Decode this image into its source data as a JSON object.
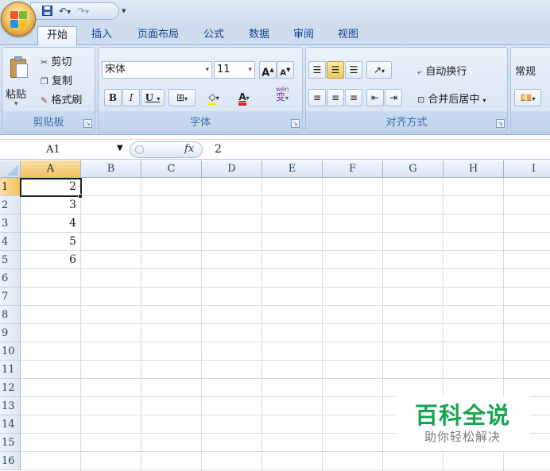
{
  "qat": {
    "save_icon": "save-icon",
    "undo_icon": "undo-icon",
    "redo_icon": "redo-icon",
    "more": "▾"
  },
  "tabs": [
    {
      "label": "开始",
      "active": true
    },
    {
      "label": "插入"
    },
    {
      "label": "页面布局"
    },
    {
      "label": "公式"
    },
    {
      "label": "数据"
    },
    {
      "label": "审阅"
    },
    {
      "label": "视图"
    }
  ],
  "clipboard": {
    "paste": "粘贴",
    "cut": "剪切",
    "copy": "复制",
    "format_painter": "格式刷",
    "group_label": "剪贴板"
  },
  "font": {
    "name": "宋体",
    "size": "11",
    "bold": "B",
    "italic": "I",
    "underline": "U",
    "font_color_glyph": "A",
    "grow": "A",
    "shrink": "A",
    "wen": "wén",
    "wen_char": "变",
    "group_label": "字体",
    "fill_color": "#f6e62a",
    "font_color": "#e0211d"
  },
  "alignment": {
    "wrap_text": "自动换行",
    "merge_center": "合并后居中",
    "group_label": "对齐方式"
  },
  "number": {
    "format": "常规"
  },
  "formula_bar": {
    "name_box": "A1",
    "fx": "fx",
    "value": "2"
  },
  "sheet": {
    "columns": [
      "A",
      "B",
      "C",
      "D",
      "E",
      "F",
      "G",
      "H",
      "I"
    ],
    "rows": [
      "1",
      "2",
      "3",
      "4",
      "5",
      "6",
      "7",
      "8",
      "9",
      "10",
      "11",
      "12",
      "13",
      "14",
      "15",
      "16"
    ],
    "values": {
      "A1": "2",
      "A2": "3",
      "A3": "4",
      "A4": "5",
      "A5": "6"
    },
    "active_cell": "A1"
  },
  "watermark": {
    "main": "百科全说",
    "sub": "助你轻松解决"
  }
}
